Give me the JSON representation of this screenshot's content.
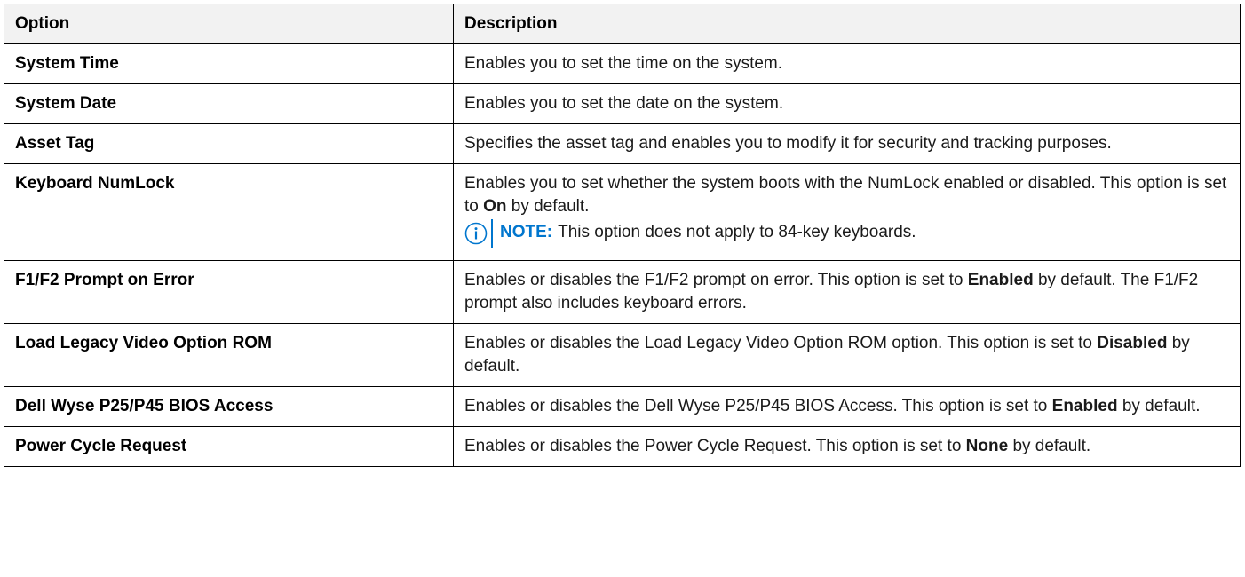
{
  "headers": {
    "option": "Option",
    "description": "Description"
  },
  "rows": [
    {
      "option": "System Time",
      "description": "Enables you to set the time on the system."
    },
    {
      "option": "System Date",
      "description": "Enables you to set the date on the system."
    },
    {
      "option": "Asset Tag",
      "description": "Specifies the asset tag and enables you to modify it for security and tracking purposes."
    },
    {
      "option": "Keyboard NumLock",
      "description_before": "Enables you to set whether the system boots with the NumLock enabled or disabled. This option is set to ",
      "description_bold": "On",
      "description_after": " by default.",
      "note_label": "NOTE:",
      "note_text": "This option does not apply to 84-key keyboards.",
      "note_icon": "info-circle-icon"
    },
    {
      "option": "F1/F2 Prompt on Error",
      "description_before": "Enables or disables the F1/F2 prompt on error. This option is set to ",
      "description_bold": "Enabled",
      "description_after": " by default. The F1/F2 prompt also includes keyboard errors."
    },
    {
      "option": "Load Legacy Video Option ROM",
      "description_before": "Enables or disables the Load Legacy Video Option ROM option. This option is set to ",
      "description_bold": "Disabled",
      "description_after": " by default."
    },
    {
      "option": "Dell Wyse P25/P45 BIOS Access",
      "description_before": "Enables or disables the Dell Wyse P25/P45 BIOS Access. This option is set to ",
      "description_bold": "Enabled",
      "description_after": " by default."
    },
    {
      "option": "Power Cycle Request",
      "description_before": "Enables or disables the Power Cycle Request. This option is set to ",
      "description_bold": "None",
      "description_after": " by default."
    }
  ],
  "colors": {
    "note_accent": "#0076ce",
    "header_bg": "#f2f2f2",
    "border": "#000000"
  }
}
